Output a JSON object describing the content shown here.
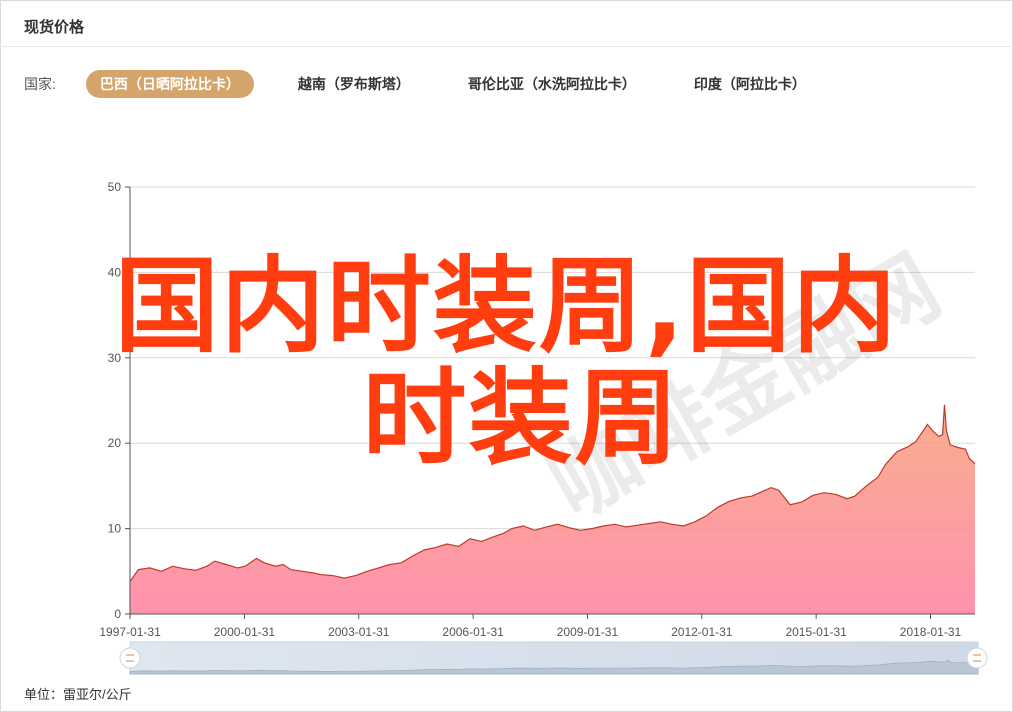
{
  "header": {
    "title": "现货价格"
  },
  "countries": {
    "label": "国家:",
    "tabs": [
      {
        "label": "巴西（日晒阿拉比卡）",
        "active": true
      },
      {
        "label": "越南（罗布斯塔）",
        "active": false
      },
      {
        "label": "哥伦比亚（水洗阿拉比卡）",
        "active": false
      },
      {
        "label": "印度（阿拉比卡）",
        "active": false
      }
    ]
  },
  "overlay": {
    "line1": "国内时装周,国内",
    "line2": "时装周"
  },
  "watermark": {
    "text": "咖啡金融网"
  },
  "footer": {
    "unit": "单位：雷亚尔/公斤"
  },
  "colors": {
    "accent": "#d4a46a",
    "line": "#c0392b",
    "area_top": "#f7a07a",
    "area_bottom": "#ff7fa0",
    "overlay_text": "#ff3d0f"
  },
  "chart_data": {
    "type": "area",
    "ylim": [
      0,
      50
    ],
    "yticks": [
      0,
      10,
      20,
      30,
      40,
      50
    ],
    "xlim": [
      1997.08,
      2019.25
    ],
    "xticks": [
      "1997-01-31",
      "2000-01-31",
      "2003-01-31",
      "2006-01-31",
      "2009-01-31",
      "2012-01-31",
      "2015-01-31",
      "2018-01-31"
    ],
    "grid": true,
    "series": [
      {
        "values": [
          [
            1997.08,
            3.8
          ],
          [
            1997.3,
            5.2
          ],
          [
            1997.6,
            5.4
          ],
          [
            1997.9,
            5.0
          ],
          [
            1998.2,
            5.6
          ],
          [
            1998.5,
            5.3
          ],
          [
            1998.8,
            5.1
          ],
          [
            1999.1,
            5.6
          ],
          [
            1999.3,
            6.2
          ],
          [
            1999.6,
            5.8
          ],
          [
            1999.9,
            5.4
          ],
          [
            2000.1,
            5.6
          ],
          [
            2000.4,
            6.5
          ],
          [
            2000.6,
            6.0
          ],
          [
            2000.9,
            5.6
          ],
          [
            2001.1,
            5.8
          ],
          [
            2001.3,
            5.2
          ],
          [
            2001.6,
            5.0
          ],
          [
            2001.9,
            4.8
          ],
          [
            2002.1,
            4.6
          ],
          [
            2002.4,
            4.5
          ],
          [
            2002.7,
            4.2
          ],
          [
            2003.0,
            4.5
          ],
          [
            2003.3,
            5.0
          ],
          [
            2003.6,
            5.4
          ],
          [
            2003.9,
            5.8
          ],
          [
            2004.2,
            6.0
          ],
          [
            2004.5,
            6.8
          ],
          [
            2004.8,
            7.5
          ],
          [
            2005.1,
            7.8
          ],
          [
            2005.4,
            8.2
          ],
          [
            2005.7,
            7.9
          ],
          [
            2006.0,
            8.8
          ],
          [
            2006.3,
            8.5
          ],
          [
            2006.6,
            9.0
          ],
          [
            2006.9,
            9.5
          ],
          [
            2007.1,
            10.0
          ],
          [
            2007.4,
            10.3
          ],
          [
            2007.7,
            9.8
          ],
          [
            2008.0,
            10.2
          ],
          [
            2008.3,
            10.5
          ],
          [
            2008.6,
            10.1
          ],
          [
            2008.9,
            9.8
          ],
          [
            2009.2,
            10.0
          ],
          [
            2009.5,
            10.3
          ],
          [
            2009.8,
            10.5
          ],
          [
            2010.1,
            10.2
          ],
          [
            2010.4,
            10.4
          ],
          [
            2010.7,
            10.6
          ],
          [
            2011.0,
            10.8
          ],
          [
            2011.3,
            10.5
          ],
          [
            2011.6,
            10.3
          ],
          [
            2011.9,
            10.8
          ],
          [
            2012.2,
            11.5
          ],
          [
            2012.5,
            12.5
          ],
          [
            2012.8,
            13.2
          ],
          [
            2013.1,
            13.6
          ],
          [
            2013.4,
            13.8
          ],
          [
            2013.6,
            14.2
          ],
          [
            2013.9,
            14.8
          ],
          [
            2014.1,
            14.5
          ],
          [
            2014.4,
            12.8
          ],
          [
            2014.7,
            13.1
          ],
          [
            2015.0,
            13.9
          ],
          [
            2015.3,
            14.2
          ],
          [
            2015.6,
            14.0
          ],
          [
            2015.9,
            13.5
          ],
          [
            2016.1,
            13.8
          ],
          [
            2016.4,
            15.0
          ],
          [
            2016.7,
            16.0
          ],
          [
            2016.9,
            17.5
          ],
          [
            2017.2,
            19.0
          ],
          [
            2017.5,
            19.6
          ],
          [
            2017.7,
            20.2
          ],
          [
            2017.9,
            21.5
          ],
          [
            2018.0,
            22.2
          ],
          [
            2018.15,
            21.4
          ],
          [
            2018.3,
            20.8
          ],
          [
            2018.4,
            21.0
          ],
          [
            2018.45,
            24.5
          ],
          [
            2018.5,
            21.5
          ],
          [
            2018.6,
            19.8
          ],
          [
            2018.8,
            19.5
          ],
          [
            2019.0,
            19.3
          ],
          [
            2019.1,
            18.2
          ],
          [
            2019.2,
            17.8
          ],
          [
            2019.25,
            17.6
          ]
        ]
      }
    ]
  }
}
